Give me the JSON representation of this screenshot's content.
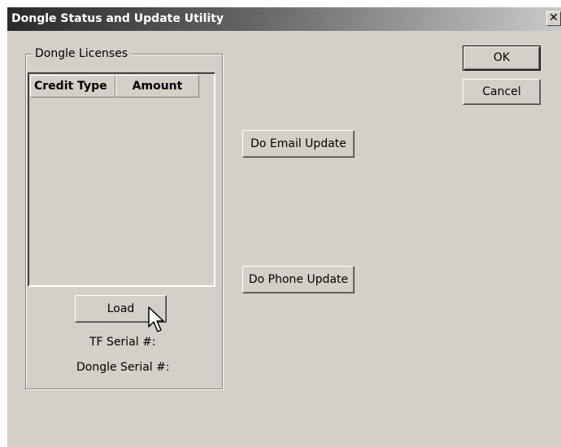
{
  "window": {
    "title": "Dongle Status and Update Utility",
    "close_glyph": "✕"
  },
  "group": {
    "label": "Dongle Licenses"
  },
  "list": {
    "columns": [
      "Credit Type",
      "Amount"
    ],
    "rows": []
  },
  "buttons": {
    "ok": "OK",
    "cancel": "Cancel",
    "email_update": "Do Email Update",
    "phone_update": "Do Phone Update",
    "load": "Load"
  },
  "labels": {
    "tf_serial": "TF Serial #:",
    "dongle_serial": "Dongle Serial #:"
  },
  "icons": {
    "close": "close-icon",
    "cursor": "mouse-pointer-icon"
  },
  "colors": {
    "dialog_face": "#d4d0c8",
    "titlebar_dark": "#2a2a2a",
    "titlebar_light": "#c9c9c9"
  }
}
